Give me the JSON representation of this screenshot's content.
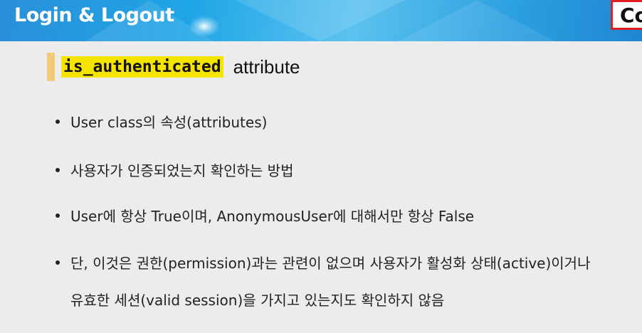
{
  "header": {
    "title": "Login & Logout",
    "corner_text": "Co"
  },
  "section": {
    "code_term": "is_authenticated",
    "heading_rest": "attribute"
  },
  "bullets": [
    "User class의 속성(attributes)",
    "사용자가 인증되었는지 확인하는 방법",
    "User에 항상 True이며, AnonymousUser에 대해서만 항상 False",
    "단, 이것은 권한(permission)과는 관련이 없으며 사용자가 활성화 상태(active)이거나"
  ],
  "bullet_4_continuation": "유효한 세션(valid session)을 가지고 있는지도 확인하지 않음"
}
